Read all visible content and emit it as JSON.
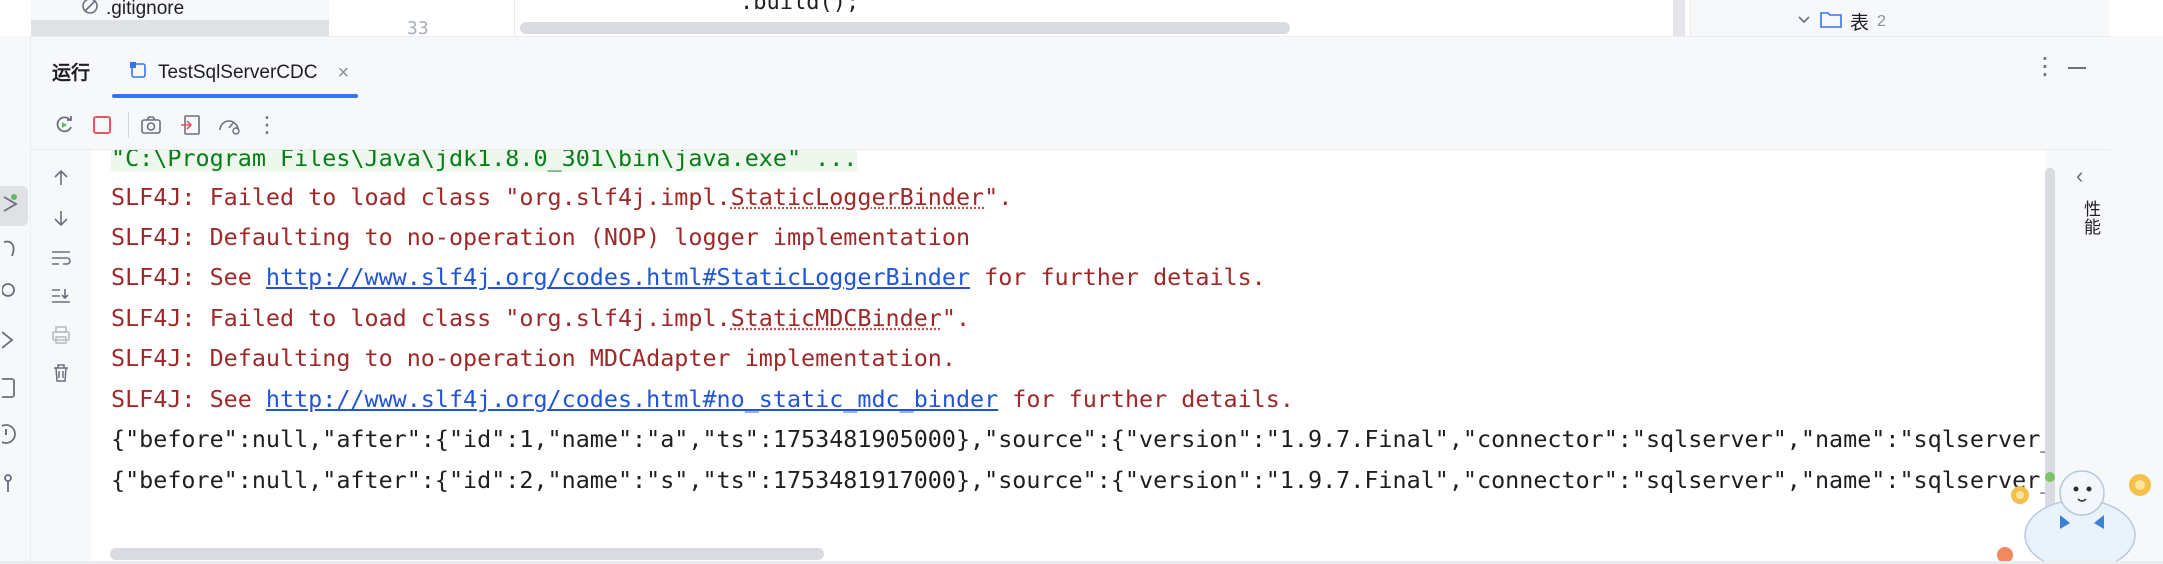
{
  "project_tree": {
    "file_name": ".gitignore"
  },
  "editor": {
    "line_number": "33",
    "code_fragment": ".build();"
  },
  "database_panel": {
    "node_label": "表",
    "node_count": "2"
  },
  "run_window": {
    "title": "运行",
    "tab": {
      "label": "TestSqlServerCDC"
    }
  },
  "toolbar": {
    "icons": [
      "rerun-icon",
      "stop-icon",
      "screenshot-icon",
      "restore-layout-icon",
      "profiler-icon",
      "more-icon"
    ]
  },
  "console_side": {
    "icons": [
      "scroll-up-icon",
      "scroll-down-icon",
      "soft-wrap-icon",
      "scroll-to-end-icon",
      "print-icon",
      "clear-icon"
    ]
  },
  "console": {
    "command_line": "\"C:\\Program Files\\Java\\jdk1.8.0_301\\bin\\java.exe\" ...",
    "lines": [
      {
        "kind": "squiggle",
        "prefix": "SLF4J: Failed to load class \"org.slf4j.impl.",
        "emph": "StaticLoggerBinder",
        "suffix": "\"."
      },
      {
        "kind": "plain",
        "text": "SLF4J: Defaulting to no-operation (NOP) logger implementation"
      },
      {
        "kind": "link",
        "prefix": "SLF4J: See ",
        "link": "http://www.slf4j.org/codes.html#StaticLoggerBinder",
        "suffix": " for further details."
      },
      {
        "kind": "squiggle",
        "prefix": "SLF4J: Failed to load class \"org.slf4j.impl.",
        "emph": "StaticMDCBinder",
        "suffix": "\"."
      },
      {
        "kind": "plain",
        "text": "SLF4J: Defaulting to no-operation MDCAdapter implementation."
      },
      {
        "kind": "link",
        "prefix": "SLF4J: See ",
        "link": "http://www.slf4j.org/codes.html#no_static_mdc_binder",
        "suffix": " for further details."
      }
    ],
    "output_lines": [
      "{\"before\":null,\"after\":{\"id\":1,\"name\":\"a\",\"ts\":1753481905000},\"source\":{\"version\":\"1.9.7.Final\",\"connector\":\"sqlserver\",\"name\":\"sqlserver_t",
      "{\"before\":null,\"after\":{\"id\":2,\"name\":\"s\",\"ts\":1753481917000},\"source\":{\"version\":\"1.9.7.Final\",\"connector\":\"sqlserver\",\"name\":\"sqlserver_"
    ]
  },
  "right_panel": {
    "label": "性能"
  },
  "colors": {
    "accent": "#3574f0",
    "error_text": "#9d2929",
    "link": "#2154d6",
    "command": "#067d17"
  }
}
